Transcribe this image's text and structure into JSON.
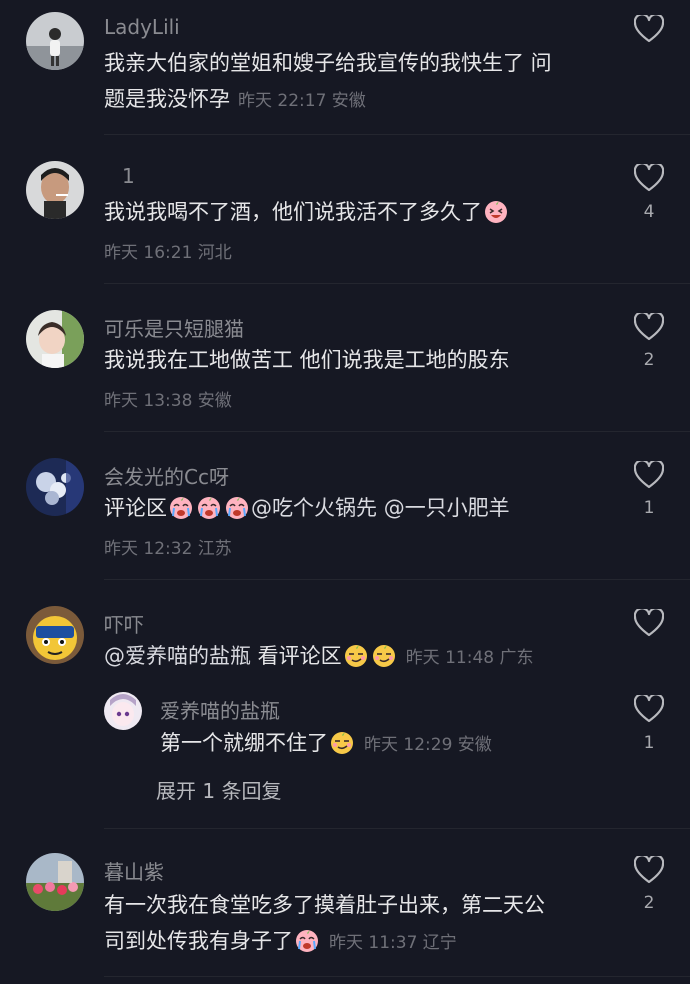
{
  "comments": [
    {
      "username": "LadyLili",
      "line1": "我亲大伯家的堂姐和嫂子给我宣传的我快生了 问",
      "line2": "题是我没怀孕",
      "meta": "昨天 22:17 安徽",
      "likes": ""
    },
    {
      "username": "1",
      "line1": "我说我喝不了酒，他们说我活不了多久了",
      "meta": "昨天 16:21 河北",
      "likes": "4"
    },
    {
      "username": "可乐是只短腿猫",
      "line1": "我说我在工地做苦工 他们说我是工地的股东",
      "meta": "昨天 13:38 安徽",
      "likes": "2"
    },
    {
      "username": "会发光的Cc呀",
      "line1_prefix": "评论区",
      "mention1": "@吃个火锅先",
      "mention2": "@一只小肥羊",
      "meta": "昨天 12:32 江苏",
      "likes": "1"
    },
    {
      "username": "吓吓",
      "mention": "@爱养喵的盐瓶",
      "line1": " 看评论区",
      "meta": "昨天 11:48 广东",
      "likes": "",
      "reply": {
        "username": "爱养喵的盐瓶",
        "line1": "第一个就绷不住了",
        "meta": "昨天 12:29 安徽",
        "likes": "1"
      },
      "expand_label": "展开 1 条回复"
    },
    {
      "username": "暮山紫",
      "line1": "有一次我在食堂吃多了摸着肚子出来，第二天公",
      "line2": "司到处传我有身子了",
      "meta": "昨天 11:37 辽宁",
      "likes": "2"
    }
  ],
  "icons": {
    "like": "heart-outline-icon",
    "emoji_laugh": "laughing-face-emoji",
    "emoji_cry": "crying-face-emoji",
    "emoji_smirk": "smirk-face-emoji"
  },
  "colors": {
    "background": "#161823",
    "username": "#8a8b91",
    "text": "#e6e6e8",
    "meta": "#6f7078"
  }
}
